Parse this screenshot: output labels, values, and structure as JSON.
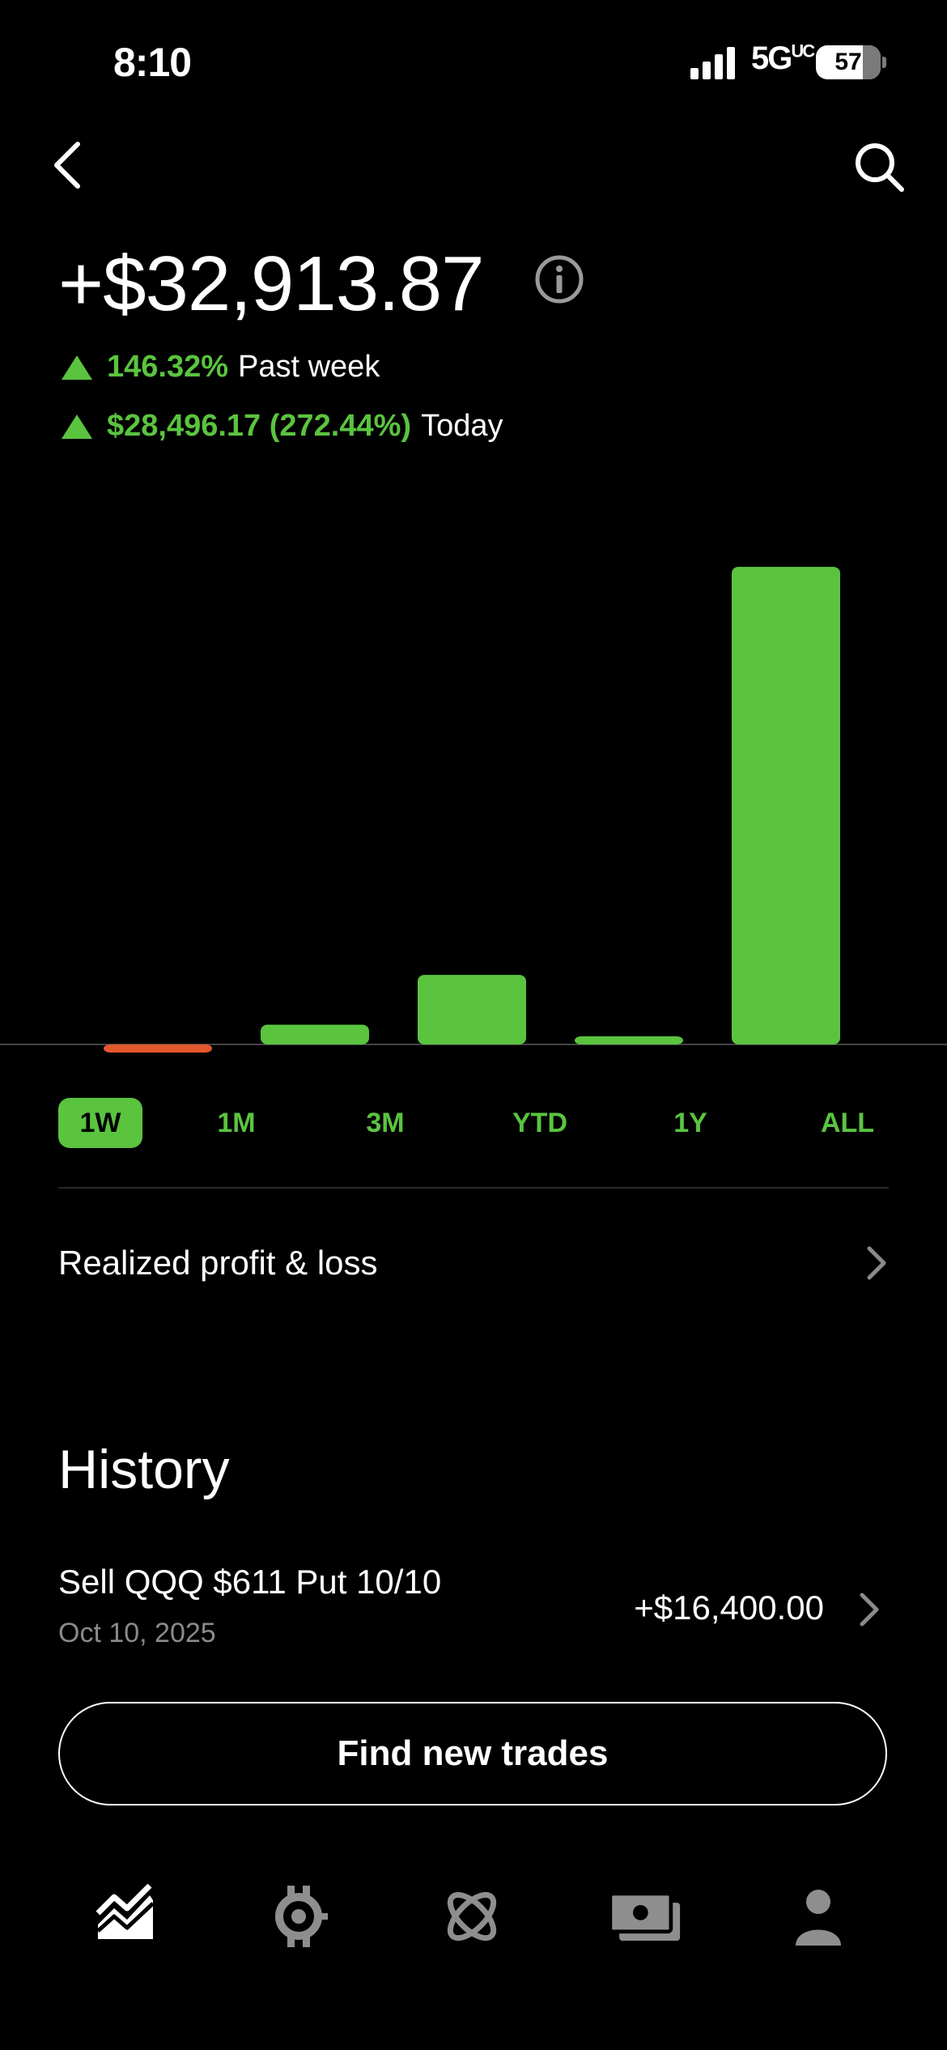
{
  "status_bar": {
    "time": "8:10",
    "network": "5G",
    "network_suffix": "UC",
    "battery": "57"
  },
  "header": {
    "value": "+$32,913.87"
  },
  "stats": {
    "week_change": "146.32%",
    "week_label": "Past week",
    "today_change": "$28,496.17 (272.44%)",
    "today_label": "Today"
  },
  "chart_data": {
    "type": "bar",
    "categories": [
      "",
      "",
      "",
      "",
      ""
    ],
    "values": [
      -220,
      1180,
      4150,
      450,
      28496
    ],
    "ylim": [
      -1000,
      28500
    ],
    "colors": {
      "positive": "#5ac43f",
      "negative": "#e4572e",
      "baseline": "#444444"
    }
  },
  "ranges": {
    "items": [
      "1W",
      "1M",
      "3M",
      "YTD",
      "1Y",
      "ALL"
    ],
    "selected": "1W"
  },
  "realized": {
    "label": "Realized profit & loss"
  },
  "history": {
    "title": "History",
    "items": [
      {
        "title": "Sell QQQ $611 Put 10/10",
        "date": "Oct 10, 2025",
        "amount": "+$16,400.00"
      }
    ]
  },
  "cta": {
    "label": "Find new trades"
  },
  "bottom_nav": {
    "items": [
      "chart-icon",
      "options-icon",
      "crypto-icon",
      "cash-icon",
      "account-icon"
    ],
    "active": "chart-icon"
  },
  "colors": {
    "accent": "#5ac43f",
    "negative": "#e4572e",
    "muted": "#8a8a8a",
    "nav_inactive": "#8e8e8e"
  }
}
